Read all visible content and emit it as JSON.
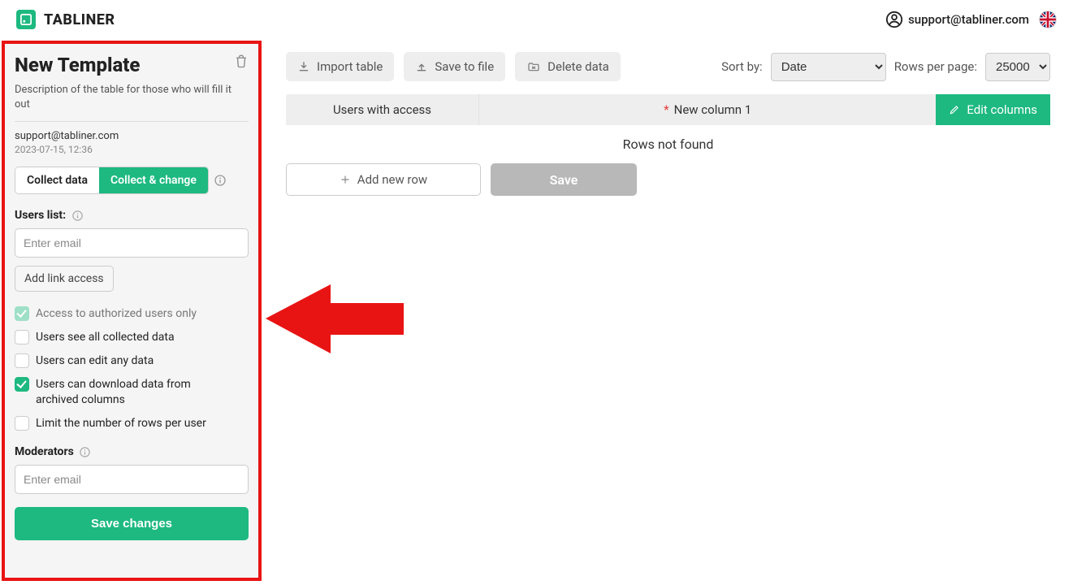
{
  "header": {
    "brand": "TABLINER",
    "user_email": "support@tabliner.com"
  },
  "sidebar": {
    "title": "New Template",
    "description": "Description of the table for those who will fill it out",
    "owner_email": "support@tabliner.com",
    "timestamp": "2023-07-15, 12:36",
    "mode_collect": "Collect data",
    "mode_collect_change": "Collect & change",
    "users_list_label": "Users list:",
    "users_list_placeholder": "Enter email",
    "add_link_access": "Add link access",
    "checks": {
      "authorized_only": "Access to authorized users only",
      "see_all": "Users see all collected data",
      "edit_any": "Users can edit any data",
      "download_archived": "Users can download data from archived columns",
      "limit_rows": "Limit the number of rows per user"
    },
    "moderators_label": "Moderators",
    "moderators_placeholder": "Enter email",
    "save_changes": "Save changes"
  },
  "main": {
    "toolbar": {
      "import": "Import table",
      "save_file": "Save to file",
      "delete": "Delete data",
      "sort_label": "Sort by:",
      "sort_value": "Date",
      "rows_label": "Rows per page:",
      "rows_value": "25000"
    },
    "columns": {
      "col1": "Users with access",
      "col2": "New column 1",
      "edit": "Edit columns"
    },
    "empty": "Rows not found",
    "add_row": "Add new row",
    "save": "Save"
  }
}
